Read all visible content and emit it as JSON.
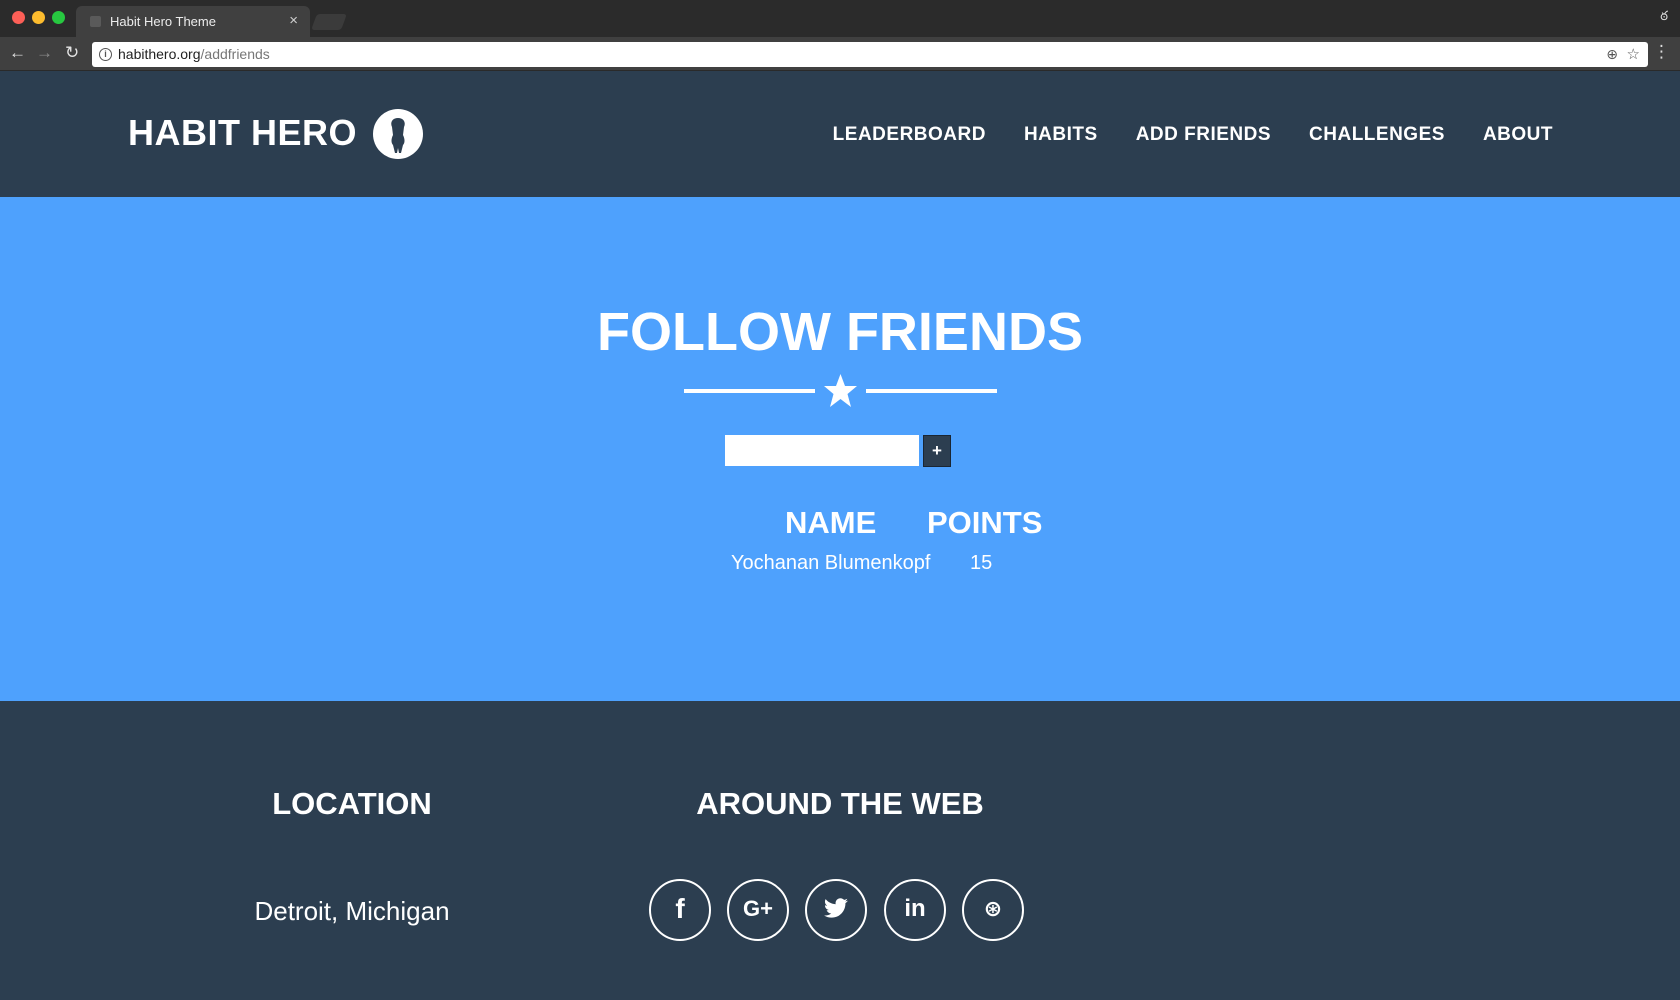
{
  "browser": {
    "tab_title": "Habit Hero Theme",
    "tab_close": "×",
    "url_host": "habithero.org",
    "url_path": "/addfriends",
    "back_glyph": "←",
    "forward_glyph": "→",
    "reload_glyph": "↻",
    "zoom_glyph": "⊕",
    "star_glyph": "☆",
    "menu_glyph": "⋮",
    "info_glyph": "i",
    "incognito_glyph": "ఠ"
  },
  "site": {
    "brand": "HABIT HERO",
    "nav": [
      "LEADERBOARD",
      "HABITS",
      "ADD FRIENDS",
      "CHALLENGES",
      "ABOUT"
    ]
  },
  "main": {
    "title": "FOLLOW FRIENDS",
    "input_value": "",
    "add_button_label": "+",
    "table": {
      "headers": [
        "NAME",
        "POINTS"
      ],
      "rows": [
        {
          "name": "Yochanan Blumenkopf",
          "points": "15"
        }
      ]
    }
  },
  "footer": {
    "location_heading": "LOCATION",
    "location_text": "Detroit, Michigan",
    "web_heading": "AROUND THE WEB",
    "social": [
      {
        "name": "facebook-icon",
        "glyph": "f"
      },
      {
        "name": "google-plus-icon",
        "glyph": "G+"
      },
      {
        "name": "twitter-icon",
        "glyph": "🐦"
      },
      {
        "name": "linkedin-icon",
        "glyph": "in"
      },
      {
        "name": "dribbble-icon",
        "glyph": "⊛"
      }
    ]
  },
  "colors": {
    "dark": "#2c3e50",
    "hero_blue": "#4ea1fd",
    "white": "#ffffff"
  }
}
